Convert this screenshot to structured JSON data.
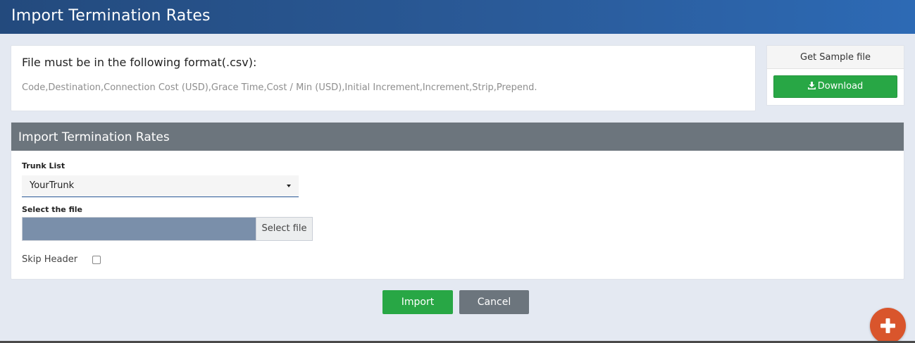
{
  "header": {
    "title": "Import Termination Rates"
  },
  "format_card": {
    "title": "File must be in the following format(.csv):",
    "fields": "Code,Destination,Connection Cost (USD),Grace Time,Cost / Min (USD),Initial Increment,Increment,Strip,Prepend."
  },
  "sample_card": {
    "title": "Get Sample file",
    "download_label": "Download",
    "download_icon": "download-icon"
  },
  "import_panel": {
    "title": "Import Termination Rates",
    "trunk_label": "Trunk List",
    "trunk_value": "YourTrunk",
    "file_label": "Select the file",
    "file_button": "Select file",
    "skip_header_label": "Skip Header",
    "skip_header_checked": false
  },
  "actions": {
    "import_label": "Import",
    "cancel_label": "Cancel"
  },
  "fab": {
    "icon": "plus-icon"
  },
  "colors": {
    "header": "#2a5a98",
    "success": "#28a745",
    "secondary": "#6c757d",
    "fab": "#d9552c",
    "file_input": "#7a8faa"
  }
}
